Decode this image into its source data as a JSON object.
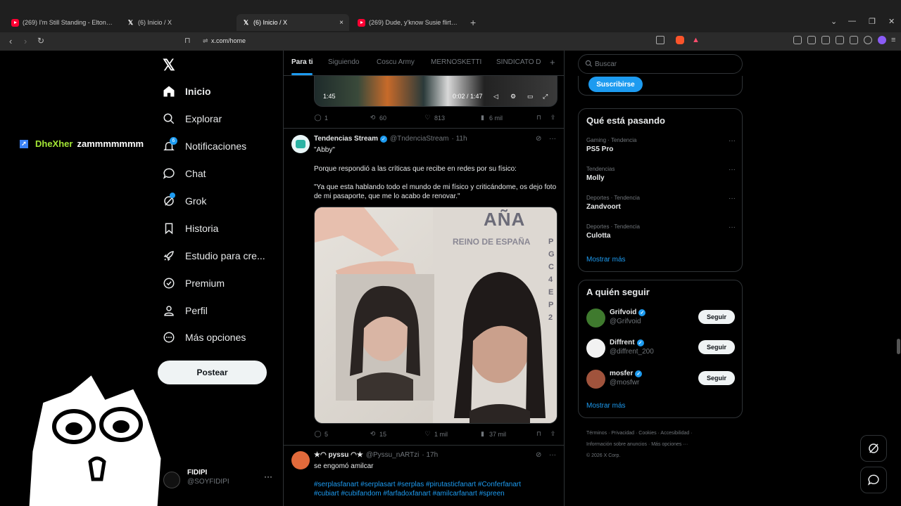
{
  "browser": {
    "tabs": [
      {
        "label": "(269) I'm Still Standing - Elton John",
        "favicon": "youtube-icon"
      },
      {
        "label": "(6) Inicio / X",
        "favicon": "x-icon"
      },
      {
        "label": "(6) Inicio / X",
        "favicon": "x-icon",
        "active": true
      },
      {
        "label": "(269) Dude, y'know Susie flirts with B",
        "favicon": "youtube-icon"
      }
    ],
    "close": "×",
    "new_tab": "+",
    "url": "x.com/home"
  },
  "nav": {
    "items": [
      {
        "label": "Inicio",
        "icon": "home-icon"
      },
      {
        "label": "Explorar",
        "icon": "search-icon"
      },
      {
        "label": "Notificaciones",
        "icon": "bell-icon",
        "badge": "6"
      },
      {
        "label": "Chat",
        "icon": "chat-icon"
      },
      {
        "label": "Grok",
        "icon": "grok-icon"
      },
      {
        "label": "Historia",
        "icon": "bookmark-icon"
      },
      {
        "label": "Estudio para cre...",
        "icon": "rocket-icon"
      },
      {
        "label": "Premium",
        "icon": "verified-icon"
      },
      {
        "label": "Perfil",
        "icon": "person-icon"
      },
      {
        "label": "Más opciones",
        "icon": "more-circle-icon"
      }
    ],
    "post_button": "Postear",
    "user": {
      "name": "FIDIPI",
      "handle": "@SOYFIDIPI",
      "more": "···"
    }
  },
  "overlay": {
    "user": "DheXher",
    "message": "zammmmmmm"
  },
  "feed": {
    "tabs": [
      "Para ti",
      "Siguiendo",
      "Coscu Army",
      "MERNOSKETTI",
      "SINDICATO D"
    ],
    "plus": "+",
    "prev_video": {
      "time_left": "1:45",
      "progress": "0:02 / 1:47"
    },
    "prev_actions": {
      "replies": "1",
      "reposts": "60",
      "likes": "813",
      "views": "6 mil"
    },
    "tweet1": {
      "name": "Tendencias Stream",
      "handle": "@TndenciaStream",
      "time": "· 11h",
      "line1": "\"Abby\"",
      "line2": "Porque respondió a las críticas que recibe en redes por su físico:",
      "line3": "\"Ya que esta hablando todo el mundo de mi físico y criticándome, os dejo foto de mi pasaporte, que me lo acabo de renovar.\"",
      "actions": {
        "replies": "5",
        "reposts": "15",
        "likes": "1 mil",
        "views": "37 mil"
      },
      "photo_text": {
        "country": "AÑA",
        "country_line": "REINO DE ESPAÑA",
        "side_code": "P GC 4 E P 2"
      }
    },
    "tweet2": {
      "name": "★◠ pyssu ◠★",
      "handle": "@Pyssu_nARTzi",
      "time": "· 17h",
      "text": "se engomó amilcar",
      "hashtags1": "#serplasfanart #serplasart #serplas #pirutasticfanart #Conferfanart",
      "hashtags2": "#cubiart #cubifandom #farfadoxfanart #amilcarfanart #spreen"
    }
  },
  "sidebar": {
    "search_placeholder": "Buscar",
    "subscribe": "Suscribirse",
    "trends_title": "Qué está pasando",
    "trends": [
      {
        "meta": "Gaming · Tendencia",
        "name": "PS5 Pro"
      },
      {
        "meta": "Tendencias",
        "name": "Molly"
      },
      {
        "meta": "Deportes · Tendencia",
        "name": "Zandvoort"
      },
      {
        "meta": "Deportes · Tendencia",
        "name": "Culotta"
      }
    ],
    "trend_more": "···",
    "show_more": "Mostrar más",
    "follow_title": "A quién seguir",
    "follows": [
      {
        "name": "Grifvoid",
        "handle": "@Grifvoid",
        "button": "Seguir"
      },
      {
        "name": "Diffrent",
        "handle": "@diffrent_200",
        "button": "Seguir"
      },
      {
        "name": "mosfer",
        "handle": "@mosfwr",
        "button": "Seguir"
      }
    ],
    "footer_line1": "Términos · Privacidad · Cookies · Accesibilidad ·",
    "footer_line2": "Información sobre anuncios · Más opciones ···",
    "footer_line3": "© 2026 X Corp."
  },
  "colors": {
    "accent": "#1d9bf0",
    "background": "#000000",
    "border": "#2f3336"
  }
}
